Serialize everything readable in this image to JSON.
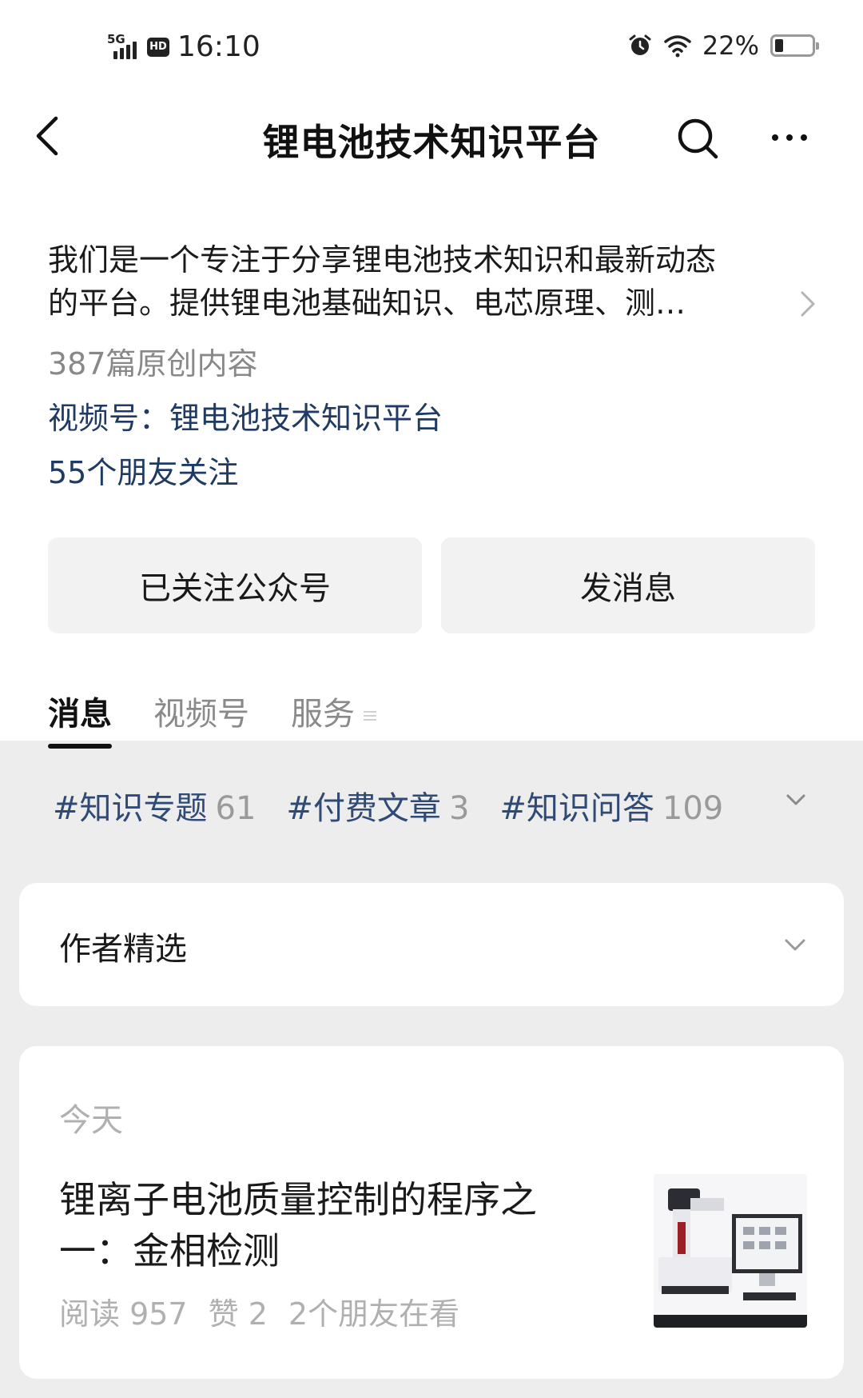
{
  "status_bar": {
    "network": "5G",
    "hd": "HD",
    "time": "16:10",
    "battery": "22%"
  },
  "nav": {
    "title": "锂电池技术知识平台"
  },
  "profile": {
    "description_line1": "我们是一个专注于分享锂电池技术知识和最新动态",
    "description_line2": "的平台。提供锂电池基础知识、电芯原理、测…",
    "original_count": "387篇原创内容",
    "video_channel": "视频号：锂电池技术知识平台",
    "friends_following": "55个朋友关注"
  },
  "actions": {
    "followed": "已关注公众号",
    "message": "发消息"
  },
  "tabs": [
    {
      "label": "消息",
      "active": true
    },
    {
      "label": "视频号",
      "active": false
    },
    {
      "label": "服务",
      "active": false
    }
  ],
  "tags": [
    {
      "name": "#知识专题",
      "count": "61"
    },
    {
      "name": "#付费文章",
      "count": "3"
    },
    {
      "name": "#知识问答",
      "count": "109"
    }
  ],
  "picks": {
    "label": "作者精选"
  },
  "feed": {
    "date": "今天",
    "article": {
      "title": "锂离子电池质量控制的程序之一：金相检测",
      "reads": "阅读 957",
      "likes": "赞 2",
      "friends_reading": "2个朋友在看"
    }
  },
  "colors": {
    "link_blue": "#1f3a63",
    "tag_blue": "#2f4a74",
    "muted": "#b0b0b0",
    "page_bg": "#ededed"
  }
}
